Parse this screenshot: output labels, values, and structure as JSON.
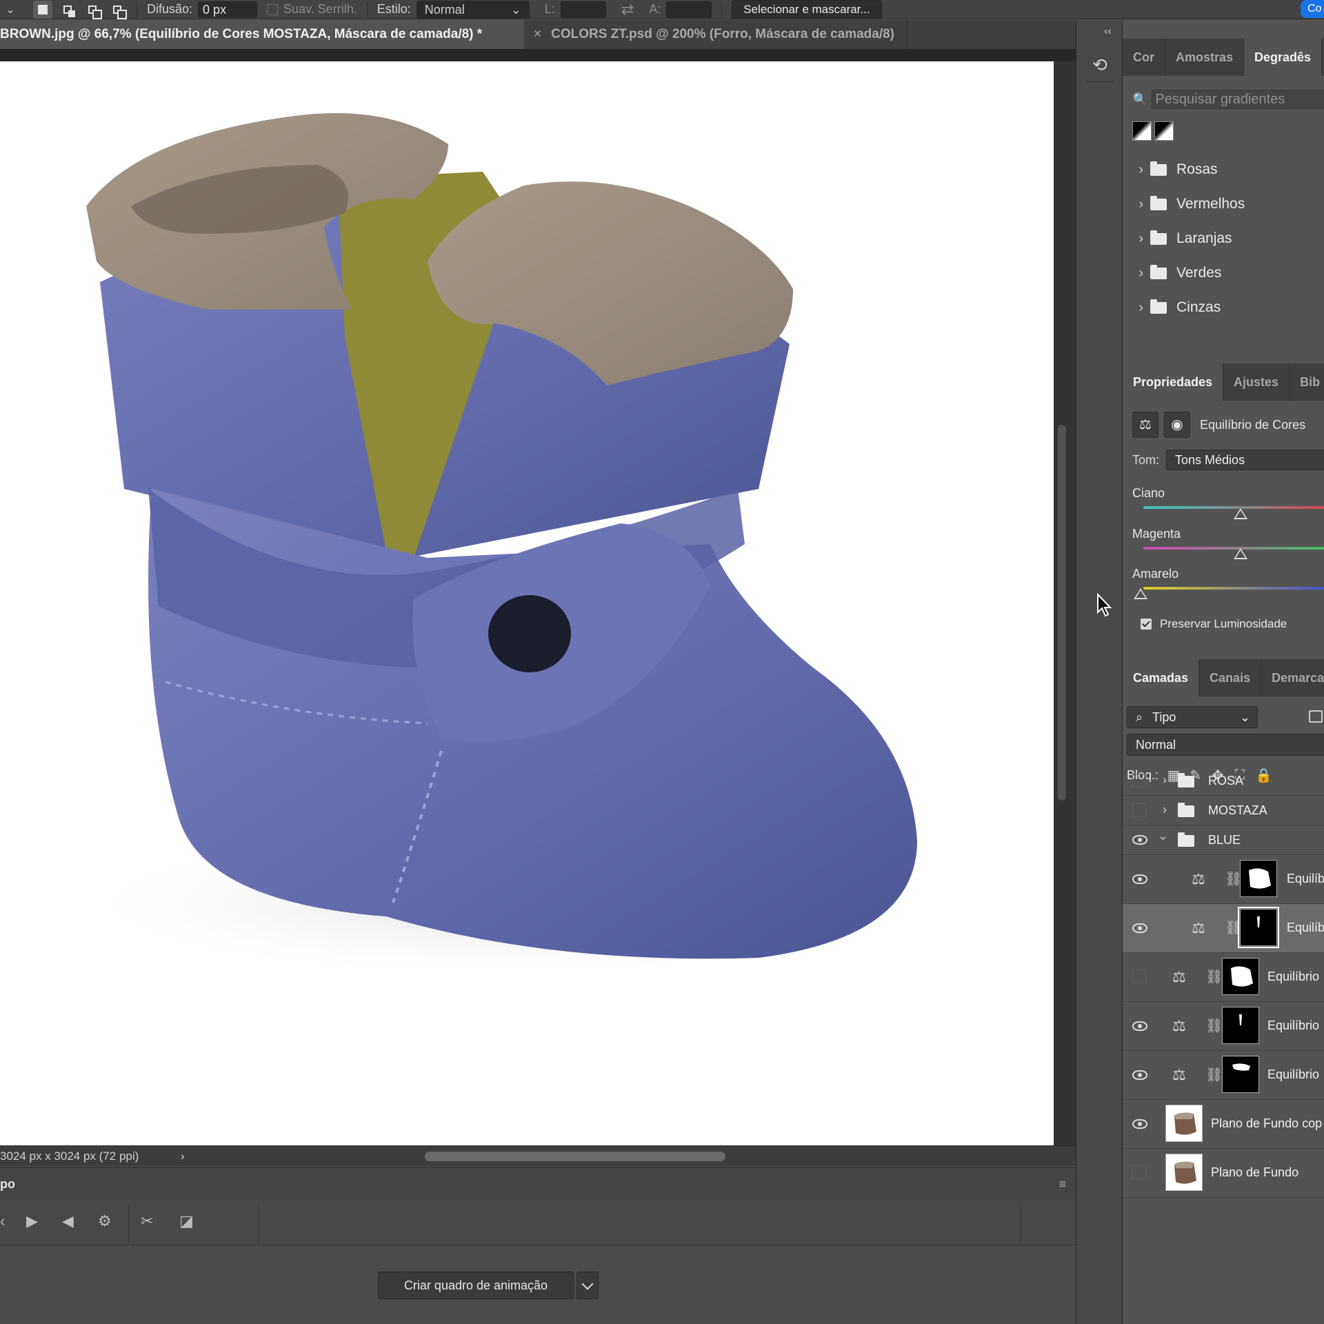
{
  "options_bar": {
    "feather_label": "Difusão:",
    "feather_value": "0 px",
    "antialias_label": "Suav. Serrilh.",
    "style_label": "Estilo:",
    "style_value": "Normal",
    "width_label": "L:",
    "height_label": "A:",
    "select_mask_label": "Selecionar e mascarar...",
    "share_label": "Co"
  },
  "tabs": [
    {
      "label": "BROWN.jpg @ 66,7% (Equilíbrio de Cores MOSTAZA, Máscara de camada/8) *"
    },
    {
      "label": "COLORS ZT.psd @ 200% (Forro, Máscara de camada/8)"
    }
  ],
  "status": {
    "dimensions": "3024 px x 3024 px (72 ppi)",
    "arrow": "›"
  },
  "timeline": {
    "title": "po",
    "create_frame_label": "Criar quadro de animação"
  },
  "gradients_panel": {
    "tabs": [
      "Cor",
      "Amostras",
      "Degradês"
    ],
    "active_tab": "Degradês",
    "search_placeholder": "Pesquisar gradientes",
    "folders": [
      "Rosas",
      "Vermelhos",
      "Laranjas",
      "Verdes",
      "Cinzas"
    ]
  },
  "properties_panel": {
    "tabs": [
      "Propriedades",
      "Ajustes",
      "Bib"
    ],
    "active_tab": "Propriedades",
    "adjustment_name": "Equilíbrio de Cores",
    "tone_label": "Tom:",
    "tone_value": "Tons Médios",
    "sliders": [
      {
        "label": "Ciano",
        "position": 0.54
      },
      {
        "label": "Magenta",
        "position": 0.54
      },
      {
        "label": "Amarelo",
        "position": 0.0
      }
    ],
    "preserve_label": "Preservar Luminosidade"
  },
  "layers_panel": {
    "tabs": [
      "Camadas",
      "Canais",
      "Demarca"
    ],
    "active_tab": "Camadas",
    "filter_label": "Tipo",
    "blend_mode": "Normal",
    "lock_label": "Bloq.:",
    "layers": [
      {
        "name": "ROSA",
        "type": "group"
      },
      {
        "name": "MOSTAZA",
        "type": "group"
      },
      {
        "name": "BLUE",
        "type": "group"
      },
      {
        "name": "Equilíb",
        "type": "adjustment"
      },
      {
        "name": "Equilíb",
        "type": "adjustment"
      },
      {
        "name": "Equilíbrio",
        "type": "adjustment"
      },
      {
        "name": "Equilíbrio",
        "type": "adjustment"
      },
      {
        "name": "Equilíbrio",
        "type": "adjustment"
      },
      {
        "name": "Plano de Fundo cop",
        "type": "pixel"
      },
      {
        "name": "Plano de Fundo",
        "type": "pixel"
      }
    ]
  },
  "colors": {
    "boot_blue": "#6a72b0",
    "fur": "#9a8c7d",
    "lining": "#8e8a38",
    "accent": "#1a73e8"
  }
}
